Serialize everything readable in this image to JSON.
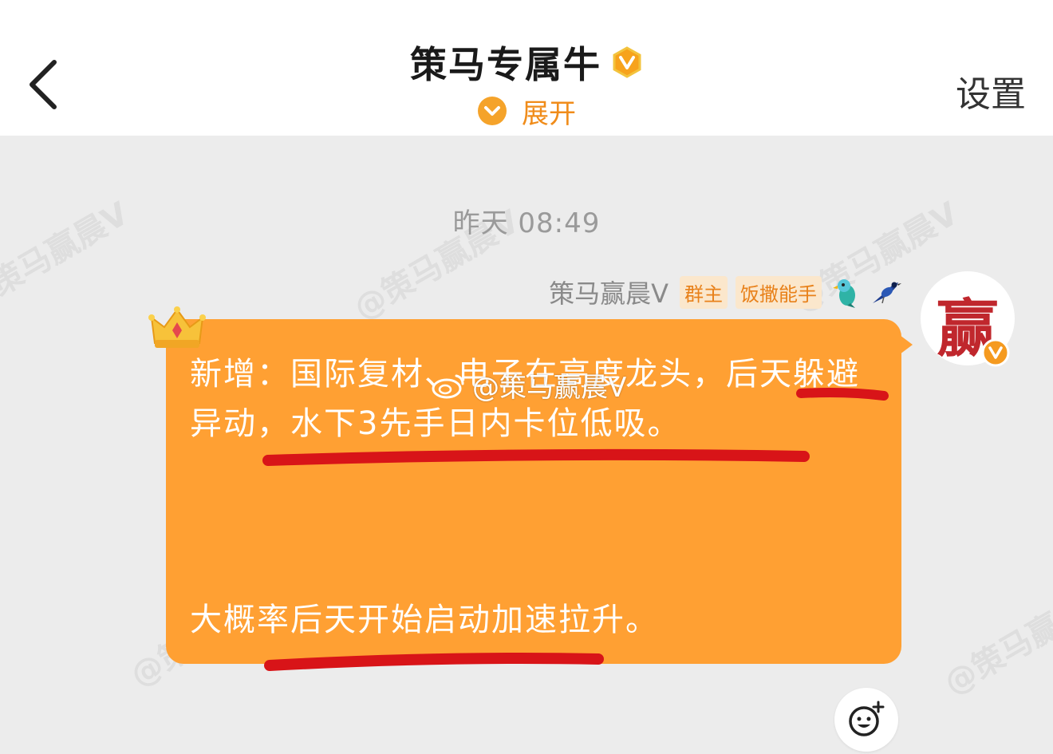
{
  "header": {
    "title": "策马专属牛",
    "expand_label": "展开",
    "settings_label": "设置",
    "back_icon": "chevron-left-icon",
    "vip_icon": "vip-v-badge-icon"
  },
  "chat": {
    "timestamp": "昨天 08:49",
    "watermark_text": "@策马赢晨V",
    "overlay_watermark": "@策马赢晨V",
    "message": {
      "sender": "策马赢晨V",
      "tags": [
        "群主",
        "饭撒能手"
      ],
      "paragraph1": "新增：国际复材、电子在高度龙头，后天躲避异动，水下3先手日内卡位低吸。",
      "paragraph2": "大概率后天开始启动加速拉升。",
      "avatar_char": "赢"
    }
  },
  "colors": {
    "accent": "#f08c1a",
    "bubble": "#ffa033",
    "underline": "#d81418",
    "tag_bg": "#fbe7cc"
  }
}
